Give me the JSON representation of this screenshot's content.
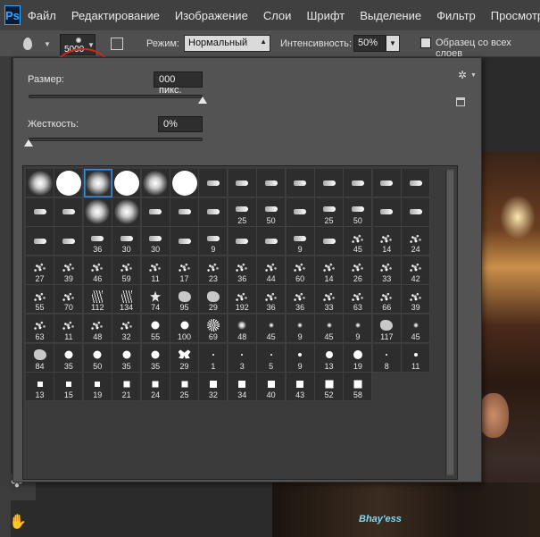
{
  "app": {
    "logo": "Ps"
  },
  "menu": [
    "Файл",
    "Редактирование",
    "Изображение",
    "Слои",
    "Шрифт",
    "Выделение",
    "Фильтр",
    "Просмотр"
  ],
  "options_bar": {
    "brush_size": "5000",
    "mode_label": "Режим:",
    "mode_value": "Нормальный",
    "intensity_label": "Интенсивность:",
    "intensity_value": "50%",
    "sample_all_label": "Образец со всех слоев"
  },
  "picker": {
    "size_label": "Размер:",
    "size_value": "000 пикс.",
    "size_slider_fraction": 1.0,
    "hardness_label": "Жесткость:",
    "hardness_value": "0%",
    "hardness_slider_fraction": 0.0,
    "gear_icon": "gear-icon",
    "new_preset_icon": "new-preset-icon"
  },
  "brush_rows": [
    [
      {
        "t": "soft",
        "s": 1.0,
        "n": ""
      },
      {
        "t": "hard",
        "s": 1.0,
        "n": ""
      },
      {
        "t": "soft",
        "s": 1.0,
        "n": "",
        "sel": true
      },
      {
        "t": "hard",
        "s": 1.0,
        "n": ""
      },
      {
        "t": "soft",
        "s": 1.0,
        "n": ""
      },
      {
        "t": "hard",
        "s": 1.0,
        "n": ""
      },
      {
        "t": "tip",
        "n": ""
      },
      {
        "t": "tip",
        "n": ""
      },
      {
        "t": "tip",
        "n": ""
      },
      {
        "t": "tip",
        "n": ""
      },
      {
        "t": "tip",
        "n": ""
      },
      {
        "t": "tip",
        "n": ""
      },
      {
        "t": "tip",
        "n": ""
      },
      {
        "t": "tip",
        "n": ""
      }
    ],
    [
      {
        "t": "tip",
        "n": ""
      },
      {
        "t": "tip",
        "n": ""
      },
      {
        "t": "soft",
        "s": 1.0,
        "n": ""
      },
      {
        "t": "soft",
        "s": 1.0,
        "n": ""
      },
      {
        "t": "tip",
        "n": ""
      },
      {
        "t": "tip",
        "n": ""
      },
      {
        "t": "tip",
        "n": ""
      },
      {
        "t": "tip",
        "n": "25"
      },
      {
        "t": "tip",
        "n": "50"
      },
      {
        "t": "tip",
        "n": ""
      },
      {
        "t": "tip",
        "n": "25"
      },
      {
        "t": "tip",
        "n": "50"
      },
      {
        "t": "tip",
        "n": ""
      },
      {
        "t": "tip",
        "n": ""
      }
    ],
    [
      {
        "t": "tip",
        "n": ""
      },
      {
        "t": "tip",
        "n": ""
      },
      {
        "t": "tip",
        "n": "36"
      },
      {
        "t": "tip",
        "n": "30"
      },
      {
        "t": "tip",
        "n": "30"
      },
      {
        "t": "tip",
        "n": ""
      },
      {
        "t": "tip",
        "n": "9"
      },
      {
        "t": "tip",
        "n": ""
      },
      {
        "t": "tip",
        "n": ""
      },
      {
        "t": "tip",
        "n": "9"
      },
      {
        "t": "tip",
        "n": ""
      },
      {
        "t": "spray",
        "n": "45"
      },
      {
        "t": "spray",
        "n": "14"
      },
      {
        "t": "spray",
        "n": "24"
      }
    ],
    [
      {
        "t": "spray",
        "n": "27"
      },
      {
        "t": "spray",
        "n": "39"
      },
      {
        "t": "spray",
        "n": "46"
      },
      {
        "t": "spray",
        "n": "59"
      },
      {
        "t": "spray",
        "n": "11"
      },
      {
        "t": "spray",
        "n": "17"
      },
      {
        "t": "spray",
        "n": "23"
      },
      {
        "t": "spray",
        "n": "36"
      },
      {
        "t": "spray",
        "n": "44"
      },
      {
        "t": "spray",
        "n": "60"
      },
      {
        "t": "spray",
        "n": "14"
      },
      {
        "t": "spray",
        "n": "26"
      },
      {
        "t": "spray",
        "n": "33"
      },
      {
        "t": "spray",
        "n": "42"
      }
    ],
    [
      {
        "t": "spray",
        "n": "55"
      },
      {
        "t": "spray",
        "n": "70"
      },
      {
        "t": "grass",
        "n": "112"
      },
      {
        "t": "grass",
        "n": "134"
      },
      {
        "t": "leaf",
        "n": "74"
      },
      {
        "t": "splat",
        "n": "95"
      },
      {
        "t": "splat",
        "n": "29"
      },
      {
        "t": "spray",
        "n": "192"
      },
      {
        "t": "spray",
        "n": "36"
      },
      {
        "t": "spray",
        "n": "36"
      },
      {
        "t": "spray",
        "n": "33"
      },
      {
        "t": "spray",
        "n": "63"
      },
      {
        "t": "spray",
        "n": "66"
      },
      {
        "t": "spray",
        "n": "39"
      }
    ],
    [
      {
        "t": "spray",
        "n": "63"
      },
      {
        "t": "spray",
        "n": "11"
      },
      {
        "t": "spray",
        "n": "48"
      },
      {
        "t": "spray",
        "n": "32"
      },
      {
        "t": "hard",
        "s": 0.45,
        "n": "55"
      },
      {
        "t": "hard",
        "s": 0.45,
        "n": "100"
      },
      {
        "t": "flower",
        "n": "69"
      },
      {
        "t": "soft",
        "s": 0.5,
        "n": "48"
      },
      {
        "t": "soft",
        "s": 0.3,
        "n": "45"
      },
      {
        "t": "soft",
        "s": 0.3,
        "n": "9"
      },
      {
        "t": "soft",
        "s": 0.3,
        "n": "45"
      },
      {
        "t": "soft",
        "s": 0.3,
        "n": "9"
      },
      {
        "t": "splat",
        "n": "117"
      },
      {
        "t": "soft",
        "s": 0.3,
        "n": "45"
      }
    ],
    [
      {
        "t": "splat",
        "n": "84"
      },
      {
        "t": "hard",
        "s": 0.45,
        "n": "35"
      },
      {
        "t": "hard",
        "s": 0.45,
        "n": "50"
      },
      {
        "t": "hard",
        "s": 0.45,
        "n": "35"
      },
      {
        "t": "hard",
        "s": 0.45,
        "n": "35"
      },
      {
        "t": "butterfly",
        "n": "29"
      },
      {
        "t": "hard",
        "s": 0.08,
        "n": "1"
      },
      {
        "t": "hard",
        "s": 0.1,
        "n": "3"
      },
      {
        "t": "hard",
        "s": 0.12,
        "n": "5"
      },
      {
        "t": "hard",
        "s": 0.2,
        "n": "9"
      },
      {
        "t": "hard",
        "s": 0.4,
        "n": "13"
      },
      {
        "t": "hard",
        "s": 0.5,
        "n": "19"
      },
      {
        "t": "hard",
        "s": 0.1,
        "n": "8"
      },
      {
        "t": "hard",
        "s": 0.2,
        "n": "11"
      }
    ],
    [
      {
        "t": "square",
        "s": 0.28,
        "n": "13"
      },
      {
        "t": "square",
        "s": 0.3,
        "n": "15"
      },
      {
        "t": "square",
        "s": 0.32,
        "n": "19"
      },
      {
        "t": "square",
        "s": 0.33,
        "n": "21"
      },
      {
        "t": "square",
        "s": 0.35,
        "n": "24"
      },
      {
        "t": "square",
        "s": 0.36,
        "n": "25"
      },
      {
        "t": "square",
        "s": 0.38,
        "n": "32"
      },
      {
        "t": "square",
        "s": 0.4,
        "n": "34"
      },
      {
        "t": "square",
        "s": 0.41,
        "n": "40"
      },
      {
        "t": "square",
        "s": 0.42,
        "n": "43"
      },
      {
        "t": "square",
        "s": 0.43,
        "n": "52"
      },
      {
        "t": "square",
        "s": 0.44,
        "n": "58"
      }
    ]
  ],
  "tools": [
    "stamp-icon",
    "hand-icon"
  ],
  "photo": {
    "shirt_text": "Bhay'ess"
  }
}
